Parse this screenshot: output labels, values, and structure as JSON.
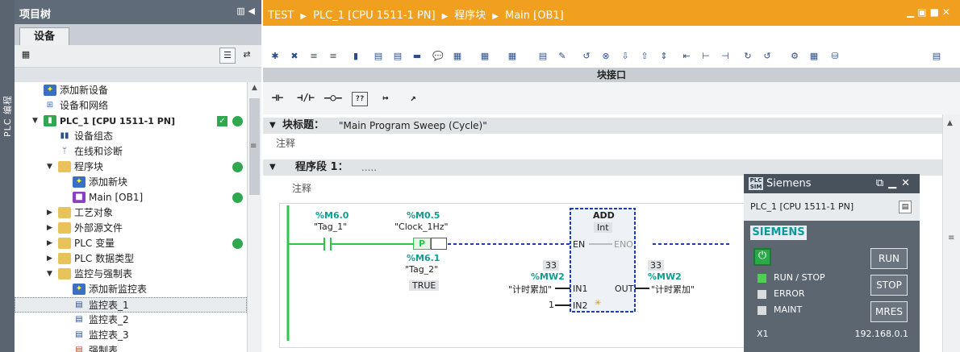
{
  "side_strip": {
    "label": "PLC 编程"
  },
  "tree": {
    "title": "项目树",
    "tab": "设备",
    "items": [
      {
        "label": "添加新设备"
      },
      {
        "label": "设备和网络"
      },
      {
        "label": "PLC_1 [CPU 1511-1 PN]"
      },
      {
        "label": "设备组态"
      },
      {
        "label": "在线和诊断"
      },
      {
        "label": "程序块"
      },
      {
        "label": "添加新块"
      },
      {
        "label": "Main [OB1]"
      },
      {
        "label": "工艺对象"
      },
      {
        "label": "外部源文件"
      },
      {
        "label": "PLC 变量"
      },
      {
        "label": "PLC 数据类型"
      },
      {
        "label": "监控与强制表"
      },
      {
        "label": "添加新监控表"
      },
      {
        "label": "监控表_1"
      },
      {
        "label": "监控表_2"
      },
      {
        "label": "监控表_3"
      },
      {
        "label": "强制表"
      }
    ]
  },
  "editor": {
    "breadcrumb": [
      "TEST",
      "PLC_1 [CPU 1511-1 PN]",
      "程序块",
      "Main [OB1]"
    ],
    "interface_label": "块接口",
    "instructions": [
      "⊣⊢",
      "⊣/⊢",
      "–○–",
      "??",
      "↦",
      "↗"
    ],
    "block_title_label": "块标题：",
    "block_title_value": "\"Main Program Sweep (Cycle)\"",
    "comment_label": "注释",
    "network_label": "程序段 1：",
    "network_dots": ".....",
    "network_comment": "注释",
    "ladder": {
      "contact1_addr": "%M6.0",
      "contact1_tag": "\"Tag_1\"",
      "contact2_addr": "%M0.5",
      "contact2_tag": "\"Clock_1Hz\"",
      "p_label": "P",
      "edge_addr": "%M6.1",
      "edge_tag": "\"Tag_2\"",
      "edge_value": "TRUE",
      "box_title": "ADD",
      "box_type": "Int",
      "en": "EN",
      "eno": "ENO",
      "in1": "IN1",
      "in2": "IN2",
      "out": "OUT",
      "in1_value": "33",
      "in1_addr": "%MW2",
      "in1_tag": "\"计时累加\"",
      "in2_value": "1",
      "out_value": "33",
      "out_addr": "%MW2",
      "out_tag": "\"计时累加\""
    }
  },
  "plcsim": {
    "title": "Siemens",
    "cpu": "PLC_1 [CPU 1511-1 PN]",
    "logo": "SIEMENS",
    "leds": [
      {
        "label": "RUN / STOP",
        "color": "#4cd14c"
      },
      {
        "label": "ERROR",
        "color": "#d8dcdf"
      },
      {
        "label": "MAINT",
        "color": "#d8dcdf"
      }
    ],
    "buttons": [
      "RUN",
      "STOP",
      "MRES"
    ],
    "port": "X1",
    "ip": "192.168.0.1"
  },
  "colors": {
    "title_orange": "#f0a01e",
    "status_green": "#2fa84f",
    "address_teal": "#119d8e",
    "ladder_green": "#2ec64a"
  }
}
